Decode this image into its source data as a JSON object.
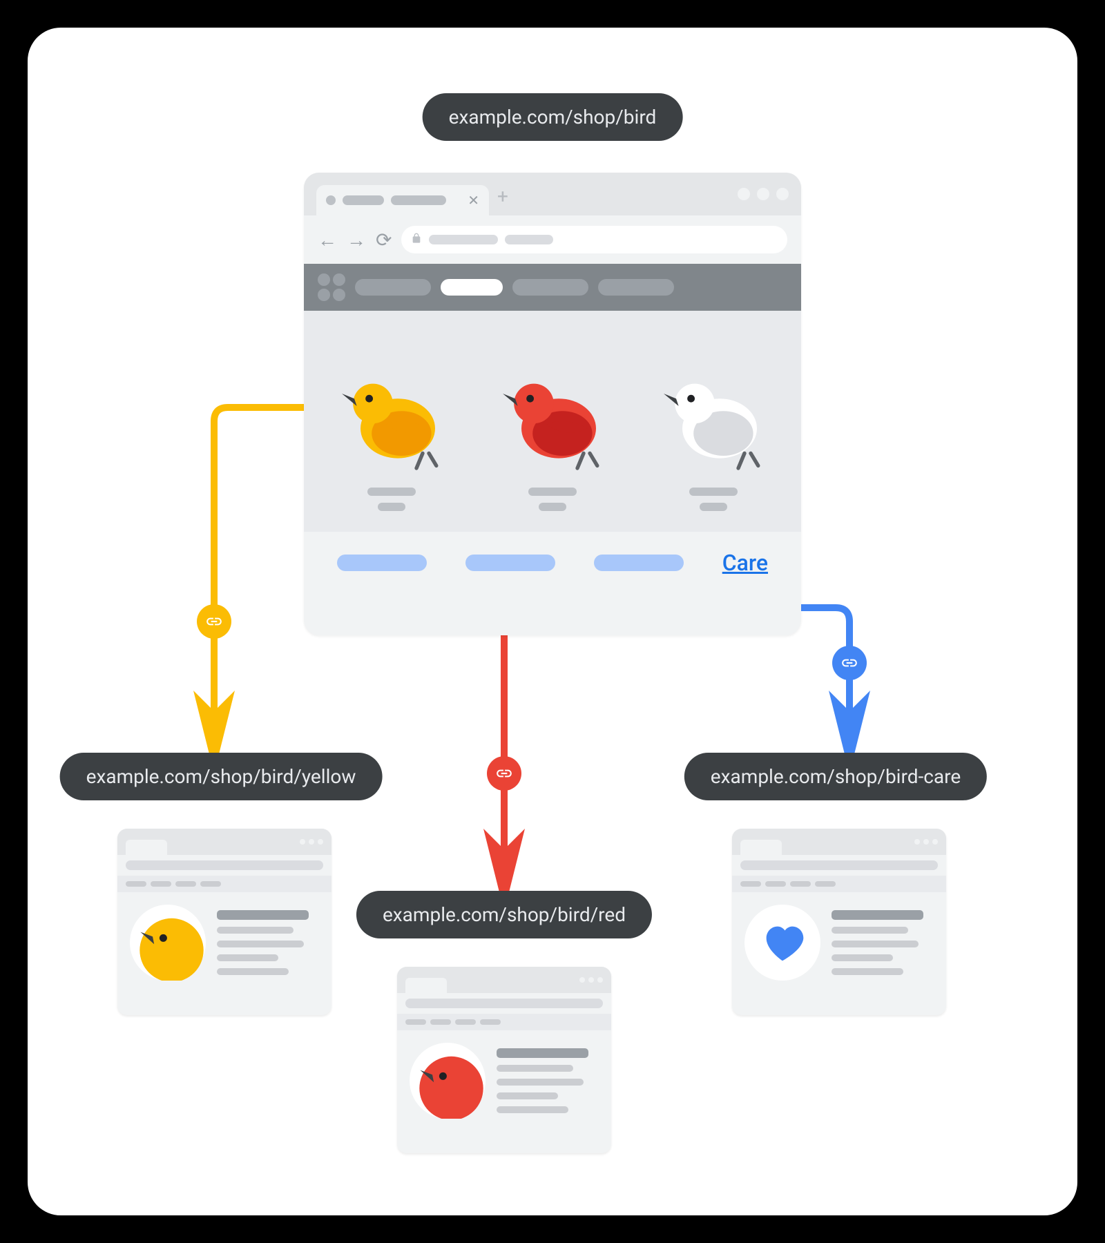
{
  "urls": {
    "root": "example.com/shop/bird",
    "yellow": "example.com/shop/bird/yellow",
    "red": "example.com/shop/bird/red",
    "care": "example.com/shop/bird-care"
  },
  "links": {
    "care_label": "Care"
  },
  "colors": {
    "yellow_arrow": "#fbbc04",
    "red_arrow": "#ea4335",
    "blue_arrow": "#4285f4",
    "pill_bg": "#3c4043",
    "blue_link": "#1a73e8"
  },
  "birds": [
    {
      "name": "yellow",
      "body": "#fbbc04",
      "shade": "#f29900"
    },
    {
      "name": "red",
      "body": "#ea4335",
      "shade": "#c5221f"
    },
    {
      "name": "white",
      "body": "#ffffff",
      "shade": "#dadce0"
    }
  ]
}
